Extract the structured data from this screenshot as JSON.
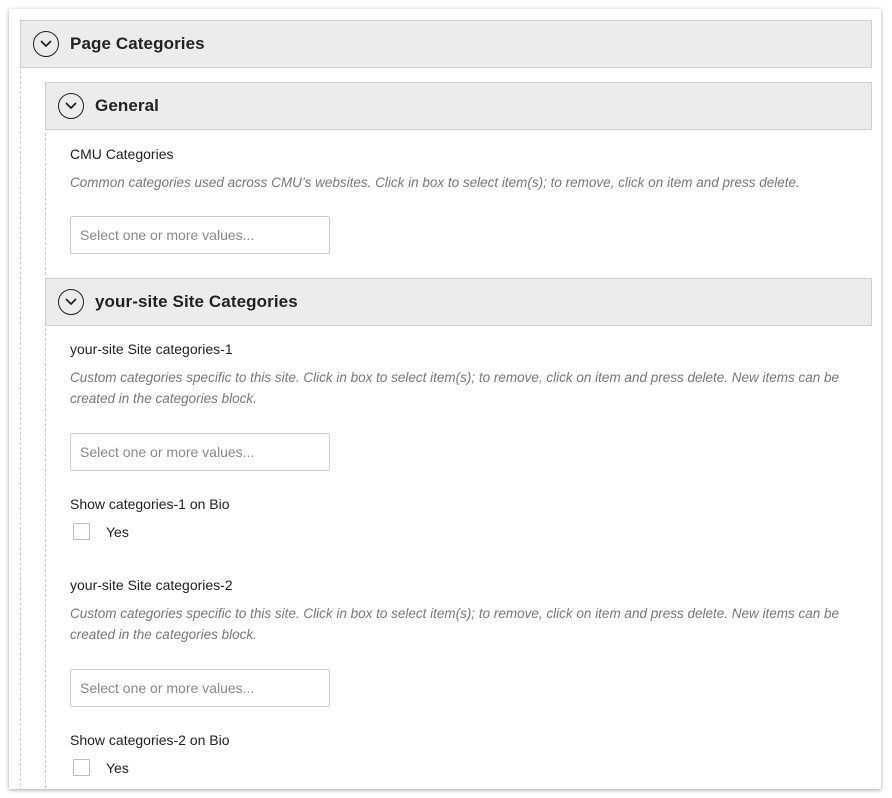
{
  "panels": {
    "page_categories": {
      "title": "Page Categories"
    },
    "general": {
      "title": "General"
    },
    "site_categories": {
      "title": "your-site Site Categories"
    }
  },
  "fields": {
    "cmu_categories": {
      "label": "CMU Categories",
      "description": "Common categories used across CMU’s websites. Click in box to select item(s); to remove, click on item and press delete.",
      "placeholder": "Select one or more values..."
    },
    "site_categories_1": {
      "label": "your-site Site categories-1",
      "description": "Custom categories specific to this site. Click in box to select item(s); to remove, click on item and press delete. New items can be created in the categories block.",
      "placeholder": "Select one or more values..."
    },
    "show_categories_1": {
      "label": "Show categories-1 on Bio",
      "option": "Yes",
      "checked": false
    },
    "site_categories_2": {
      "label": "your-site Site categories-2",
      "description": "Custom categories specific to this site. Click in box to select item(s); to remove, click on item and press delete. New items can be created in the categories block.",
      "placeholder": "Select one or more values..."
    },
    "show_categories_2": {
      "label": "Show categories-2 on Bio",
      "option": "Yes",
      "checked": false
    }
  },
  "icons": {
    "panel_toggle": "chevron-down-circle-icon"
  },
  "colors": {
    "panel_header_bg": "#ececec",
    "description_text": "#777777",
    "dashed_guide": "#c8c8c8"
  }
}
